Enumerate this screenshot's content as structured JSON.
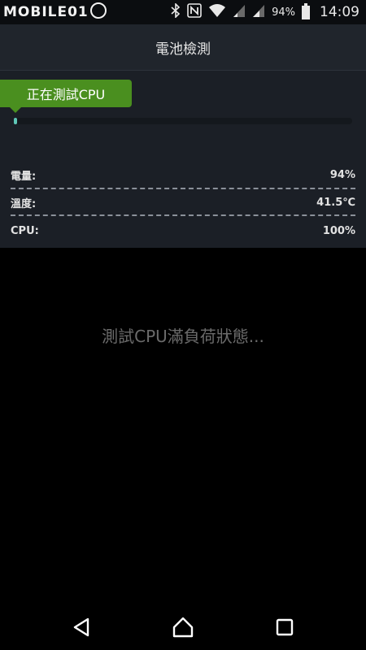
{
  "status_bar": {
    "watermark": "MOBILE01",
    "battery_percent": "94%",
    "time": "14:09"
  },
  "header": {
    "title": "電池檢測"
  },
  "progress": {
    "tag_label": "正在測試CPU",
    "value": 0.01,
    "fill_color": "#5fc7b7"
  },
  "stats": {
    "battery_label": "電量:",
    "battery_value": "94%",
    "temp_label": "溫度:",
    "temp_value": "41.5℃",
    "cpu_label": "CPU:",
    "cpu_value": "100%"
  },
  "main": {
    "message": "測試CPU滿負荷狀態..."
  },
  "icons": {
    "bluetooth": "bluetooth-icon",
    "nfc": "nfc-icon",
    "wifi": "wifi-icon",
    "signal": "signal-icon",
    "battery": "battery-icon",
    "back": "back-icon",
    "home": "home-icon",
    "recents": "recents-icon"
  },
  "colors": {
    "accent_green": "#4a8f1f",
    "header_bg": "#20252c",
    "panel_bg": "#1b1f26"
  }
}
